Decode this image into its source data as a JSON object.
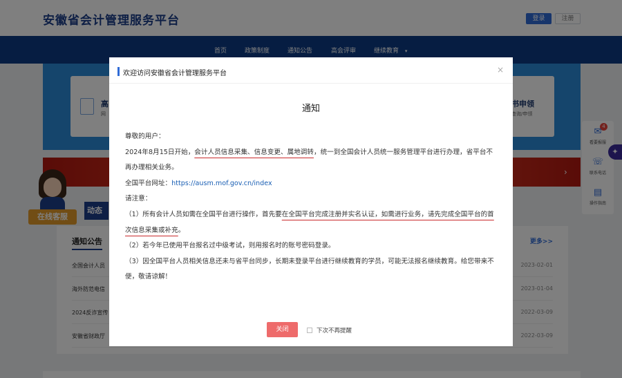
{
  "header": {
    "site_title": "安徽省会计管理服务平台",
    "login_label": "登录",
    "register_label": "注册"
  },
  "nav": {
    "items": [
      {
        "label": "首页"
      },
      {
        "label": "政策制度"
      },
      {
        "label": "通知公告"
      },
      {
        "label": "高会评审"
      },
      {
        "label": "继续教育"
      }
    ]
  },
  "quick": {
    "left_card_title": "高",
    "left_card_sub": "网",
    "right_card_title": "书申领",
    "right_card_sub": "查询/申领"
  },
  "background": {
    "dynamic_label": "动态",
    "news_title": "通知公告",
    "news_more": "更多>>",
    "news": [
      {
        "text": "全国会计人员",
        "date": "2023-02-01"
      },
      {
        "text": "海外防范电信",
        "date": "2023-01-04"
      },
      {
        "text": "2024反诈宣传",
        "date": "2022-03-09"
      },
      {
        "text": "安徽省财政厅",
        "date": "2022-03-09"
      }
    ],
    "customer_service_label": "在线客服"
  },
  "side": {
    "badge_count": "4",
    "items": [
      {
        "label": "看要报服",
        "icon": "chat-icon"
      },
      {
        "label": "联系电话",
        "icon": "phone-icon"
      },
      {
        "label": "操作指南",
        "icon": "guide-icon"
      }
    ]
  },
  "modal": {
    "title": "欢迎访问安徽省会计管理服务平台",
    "close_glyph": "×",
    "heading": "通知",
    "greeting": "尊敬的用户：",
    "p1_prefix": "2024年8月15日开始，",
    "p1_underlined": "会计人员信息采集、信息变更、属地调转",
    "p1_suffix": "，统一到全国会计人员统一服务管理平台进行办理，省平台不再办理相关业务。",
    "platform_url_label": "全国平台网址：",
    "platform_url": "https://ausm.mof.gov.cn/index",
    "note_label": "请注意：",
    "n1_prefix": "（1）所有会计人员如需在全国平台进行操作，首先要",
    "n1_underlined": "在全国平台完成注册并实名认证，如需进行业务，请先完成全国平台的首次信息采集或补充",
    "n1_suffix": "。",
    "n2": "（2）若今年已使用平台报名过中级考试，则用报名时的账号密码登录。",
    "n3": "（3）因全国平台人员相关信息还未与省平台同步，长期未登录平台进行继续教育的学员，可能无法报名继续教育。给您带来不便，敬请谅解！",
    "close_button": "关闭",
    "dont_remind": "下次不再提醒"
  }
}
